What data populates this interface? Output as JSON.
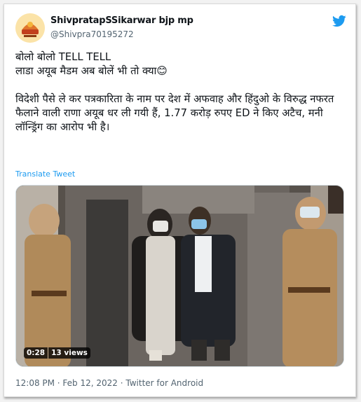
{
  "tweet": {
    "display_name": "ShivpratapSSikarwar bjp mp",
    "handle": "@Shivpra70195272",
    "text": "बोलो बोलो TELL TELL\nलाडा अयूब मैडम अब बोलें भी तो क्या😊\n\nविदेशी पैसे ले कर पत्रकारिता के नाम पर देश में अफवाह और हिंदुओ के विरुद्ध नफरत फैलाने वाली राणा अयूब धर ली गयी हैं, 1.77 करोड़ रुपए ED ने किए अटैच, मनी लॉन्ड्रिंग का आरोप भी है।",
    "translate_label": "Translate Tweet",
    "timestamp": "12:08 PM · Feb 12, 2022 · Twitter for Android"
  },
  "video": {
    "duration": "0:28",
    "views": "13 views"
  },
  "icons": {
    "avatar": "avatar-logo",
    "twitter": "twitter-bird-icon"
  },
  "colors": {
    "link": "#1d9bf0",
    "twitter_brand": "#1d9bf0",
    "meta_text": "#536471"
  }
}
